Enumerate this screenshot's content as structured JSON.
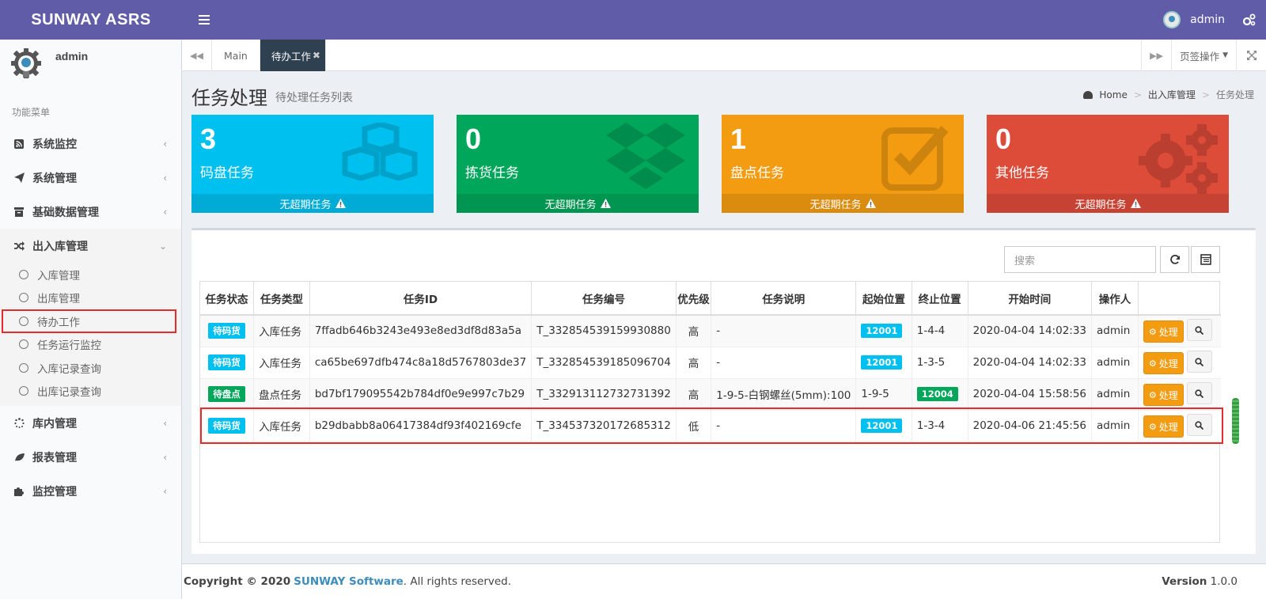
{
  "header": {
    "brand": "SUNWAY ASRS",
    "username": "admin"
  },
  "sidebar": {
    "username": "admin",
    "menu_header": "功能菜单",
    "items": [
      {
        "label": "系统监控",
        "icon": "rss-icon"
      },
      {
        "label": "系统管理",
        "icon": "paper-plane-icon"
      },
      {
        "label": "基础数据管理",
        "icon": "archive-icon"
      },
      {
        "label": "出入库管理",
        "icon": "random-icon",
        "open": true
      },
      {
        "label": "库内管理",
        "icon": "spinner-icon"
      },
      {
        "label": "报表管理",
        "icon": "leaf-icon"
      },
      {
        "label": "监控管理",
        "icon": "puzzle-icon"
      }
    ],
    "submenu": [
      "入库管理",
      "出库管理",
      "待办工作",
      "任务运行监控",
      "入库记录查询",
      "出库记录查询"
    ]
  },
  "tabs": {
    "items": [
      "Main",
      "待办工作"
    ],
    "ops_label": "页签操作"
  },
  "page": {
    "title": "任务处理",
    "subtitle": "待处理任务列表",
    "breadcrumb": [
      "Home",
      "出入库管理",
      "任务处理"
    ]
  },
  "stats": [
    {
      "count": "3",
      "label": "码盘任务",
      "footer": "无超期任务",
      "color": "#00c0ef"
    },
    {
      "count": "0",
      "label": "拣货任务",
      "footer": "无超期任务",
      "color": "#00a65a"
    },
    {
      "count": "1",
      "label": "盘点任务",
      "footer": "无超期任务",
      "color": "#f39c12"
    },
    {
      "count": "0",
      "label": "其他任务",
      "footer": "无超期任务",
      "color": "#dd4b39"
    }
  ],
  "search": {
    "placeholder": "搜索"
  },
  "table": {
    "columns": [
      "任务状态",
      "任务类型",
      "任务ID",
      "任务编号",
      "优先级",
      "任务说明",
      "起始位置",
      "终止位置",
      "开始时间",
      "操作人",
      ""
    ],
    "process_label": "处理",
    "rows": [
      {
        "status": "待码货",
        "type": "入库任务",
        "id": "7ffadb646b3243e493e8ed3df8d83a5a",
        "no": "T_332854539159930880",
        "priority": "高",
        "desc": "-",
        "from": "12001",
        "to": "1-4-4",
        "start": "2020-04-04 14:02:33",
        "operator": "admin"
      },
      {
        "status": "待码货",
        "type": "入库任务",
        "id": "ca65be697dfb474c8a18d5767803de37",
        "no": "T_332854539185096704",
        "priority": "高",
        "desc": "-",
        "from": "12001",
        "to": "1-3-5",
        "start": "2020-04-04 14:02:33",
        "operator": "admin"
      },
      {
        "status": "待盘点",
        "type": "盘点任务",
        "id": "bd7bf179095542b784df0e9e997c7b29",
        "no": "T_332913112732731392",
        "priority": "高",
        "desc": "1-9-5-白钢螺丝(5mm):100",
        "from": "1-9-5",
        "to": "12004",
        "start": "2020-04-04 15:58:56",
        "operator": "admin"
      },
      {
        "status": "待码货",
        "type": "入库任务",
        "id": "b29dbabb8a06417384df93f402169cfe",
        "no": "T_334537320172685312",
        "priority": "低",
        "desc": "-",
        "from": "12001",
        "to": "1-3-4",
        "start": "2020-04-06 21:45:56",
        "operator": "admin"
      }
    ]
  },
  "footer": {
    "copyright_prefix": "Copyright © 2020",
    "brand": "SUNWAY Software",
    "suffix": ". All rights reserved.",
    "version_label": "Version",
    "version": "1.0.0"
  }
}
